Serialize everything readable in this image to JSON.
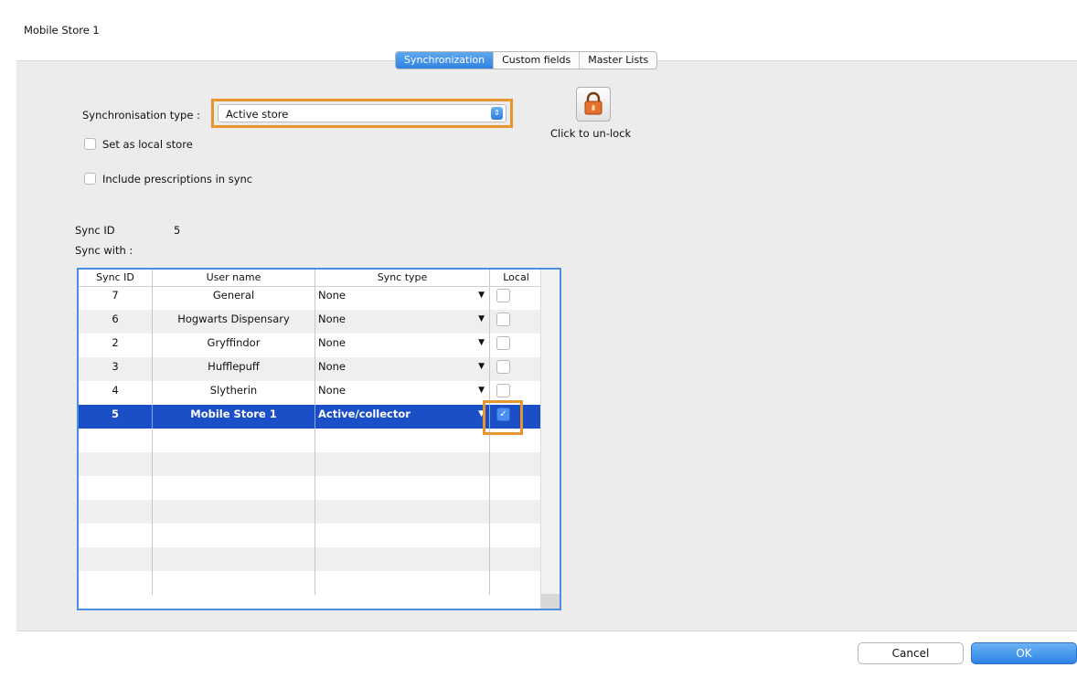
{
  "window": {
    "title": "Mobile Store 1"
  },
  "tabs": [
    {
      "label": "Synchronization",
      "active": true
    },
    {
      "label": "Custom fields",
      "active": false
    },
    {
      "label": "Master Lists",
      "active": false
    }
  ],
  "form": {
    "sync_type_label": "Synchronisation type :",
    "sync_type_value": "Active store",
    "set_local_label": "Set as local store",
    "set_local_checked": false,
    "include_prescriptions_label": "Include prescriptions in sync",
    "include_prescriptions_checked": false,
    "lock_label": "Click to un-lock",
    "sync_id_label": "Sync ID",
    "sync_id_value": "5",
    "sync_with_label": "Sync with :"
  },
  "table": {
    "headers": [
      "Sync ID",
      "User name",
      "Sync type",
      "Local"
    ],
    "rows": [
      {
        "sync_id": "7",
        "user_name": "General",
        "sync_type": "None",
        "local": false
      },
      {
        "sync_id": "6",
        "user_name": "Hogwarts Dispensary",
        "sync_type": "None",
        "local": false
      },
      {
        "sync_id": "2",
        "user_name": "Gryffindor",
        "sync_type": "None",
        "local": false
      },
      {
        "sync_id": "3",
        "user_name": "Hufflepuff",
        "sync_type": "None",
        "local": false
      },
      {
        "sync_id": "4",
        "user_name": "Slytherin",
        "sync_type": "None",
        "local": false
      },
      {
        "sync_id": "5",
        "user_name": "Mobile Store 1",
        "sync_type": "Active/collector",
        "local": true,
        "selected": true
      }
    ]
  },
  "buttons": {
    "cancel": "Cancel",
    "ok": "OK"
  },
  "colors": {
    "highlight": "#e8952e",
    "selection": "#1a4fc8",
    "accent": "#2f82e2"
  }
}
